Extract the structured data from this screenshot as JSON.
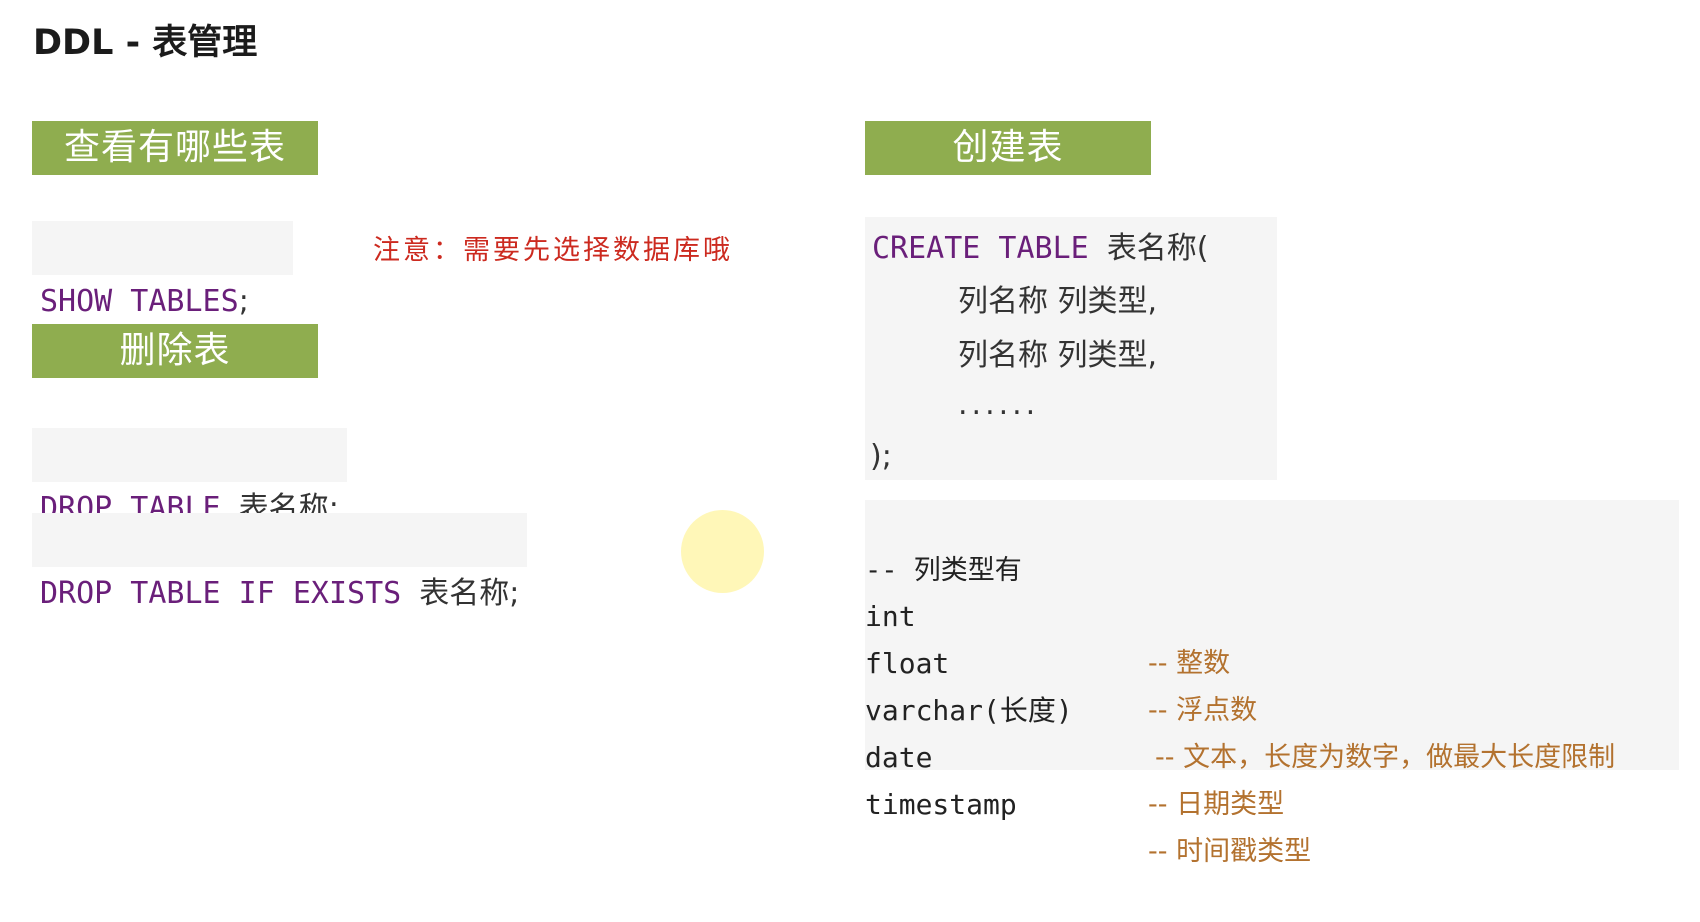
{
  "title": "DDL - 表管理",
  "sections": {
    "show": "查看有哪些表",
    "drop": "删除表",
    "create": "创建表"
  },
  "show_tables": {
    "keywords": "SHOW TABLES",
    "semicolon": ";",
    "note": "注意：需要先选择数据库哦"
  },
  "drop_table": {
    "keywords": "DROP TABLE",
    "name": "表名称",
    "semicolon": ";"
  },
  "drop_if_exists": {
    "keywords": "DROP TABLE IF EXISTS",
    "name": "表名称",
    "semicolon": ";"
  },
  "create_table": {
    "keywords": "CREATE TABLE",
    "name": "表名称(",
    "column_line_1": "列名称 列类型,",
    "column_line_2": "列名称 列类型,",
    "ellipsis": "......",
    "closing": ");"
  },
  "column_types": {
    "header": "-- 列类型有",
    "rows": [
      {
        "type": "int",
        "comment": "-- 整数"
      },
      {
        "type": "float",
        "comment": "-- 浮点数"
      },
      {
        "type": "varchar(长度)",
        "comment": "-- 文本，长度为数字，做最大长度限制"
      },
      {
        "type": "date",
        "comment": "-- 日期类型"
      },
      {
        "type": "timestamp",
        "comment": "-- 时间戳类型"
      }
    ]
  },
  "colors": {
    "section_tag_bg": "#8fad4f",
    "keyword": "#6a1f7a",
    "comment": "#b3722f",
    "note": "#cc2a1f",
    "code_bg": "#f5f5f5"
  }
}
